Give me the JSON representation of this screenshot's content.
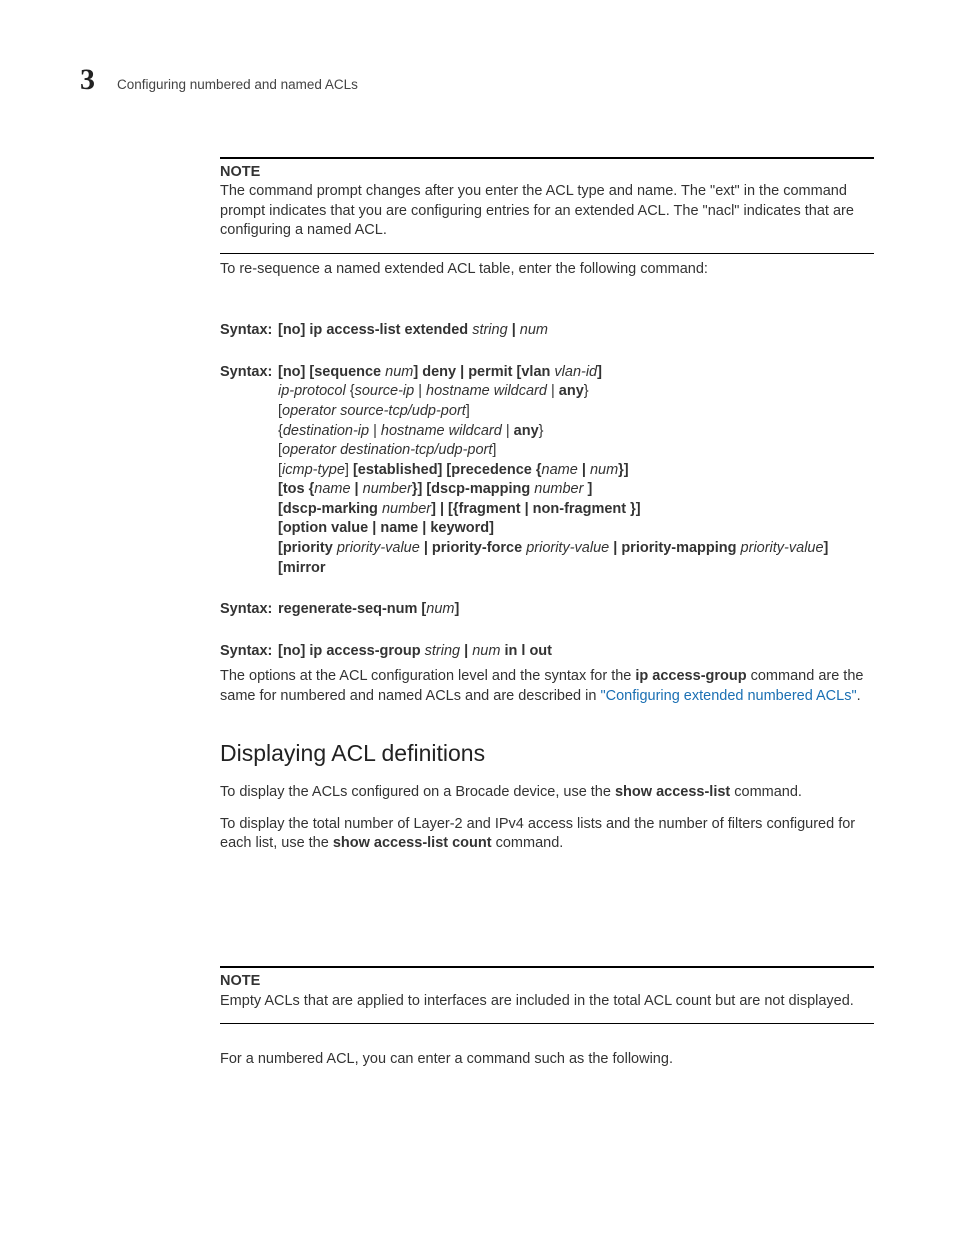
{
  "header": {
    "chapter_number": "3",
    "running_head": "Configuring numbered and named ACLs"
  },
  "note1": {
    "label": "NOTE",
    "text": " The command prompt changes after you enter the ACL type and name. The \"ext\" in the command prompt indicates that you are configuring entries for an extended ACL. The \"nacl\" indicates that are configuring a named ACL."
  },
  "para_reseq": "To re-sequence a named extended ACL table, enter the following command:",
  "syntax1": {
    "label": "Syntax:",
    "parts": [
      {
        "t": "[no] ip access-list extended ",
        "b": true
      },
      {
        "t": "string",
        "i": true
      },
      {
        "t": " | ",
        "b": true
      },
      {
        "t": "num",
        "i": true
      }
    ]
  },
  "syntax2": {
    "label": "Syntax:",
    "lines": [
      [
        {
          "t": "[no] [sequence ",
          "b": true
        },
        {
          "t": "num",
          "i": true
        },
        {
          "t": "] deny | permit  [vlan ",
          "b": true
        },
        {
          "t": "vlan-id",
          "i": true
        },
        {
          "t": "]",
          "b": true
        }
      ],
      [
        {
          "t": "ip-protocol",
          "i": true
        },
        {
          "t": " {"
        },
        {
          "t": "source-ip",
          "i": true
        },
        {
          "t": " | "
        },
        {
          "t": "hostname wildcard",
          "i": true
        },
        {
          "t": " | "
        },
        {
          "t": "any",
          "b": true
        },
        {
          "t": "}"
        }
      ],
      [
        {
          "t": "["
        },
        {
          "t": "operator source-tcp/udp-port",
          "i": true
        },
        {
          "t": "]"
        }
      ],
      [
        {
          "t": "{"
        },
        {
          "t": "destination-ip",
          "i": true
        },
        {
          "t": " | "
        },
        {
          "t": "hostname wildcard",
          "i": true
        },
        {
          "t": " | "
        },
        {
          "t": "any",
          "b": true
        },
        {
          "t": "}"
        }
      ],
      [
        {
          "t": "["
        },
        {
          "t": "operator destination-tcp/udp-port",
          "i": true
        },
        {
          "t": "]"
        }
      ],
      [
        {
          "t": "["
        },
        {
          "t": "icmp-type",
          "i": true
        },
        {
          "t": "] "
        },
        {
          "t": "[established] [precedence {",
          "b": true
        },
        {
          "t": "name",
          "i": true
        },
        {
          "t": " | ",
          "b": true
        },
        {
          "t": "num",
          "i": true
        },
        {
          "t": "}]",
          "b": true
        }
      ],
      [
        {
          "t": "[tos {",
          "b": true
        },
        {
          "t": "name",
          "i": true
        },
        {
          "t": " | ",
          "b": true
        },
        {
          "t": "number",
          "i": true
        },
        {
          "t": "}] [dscp-mapping ",
          "b": true
        },
        {
          "t": "number",
          "i": true
        },
        {
          "t": " ]",
          "b": true
        }
      ],
      [
        {
          "t": "[dscp-marking ",
          "b": true
        },
        {
          "t": "number",
          "i": true
        },
        {
          "t": "] | [{fragment | non-fragment }]",
          "b": true
        }
      ],
      [
        {
          "t": "[option value | name | keyword]",
          "b": true
        }
      ],
      [
        {
          "t": "[priority ",
          "b": true
        },
        {
          "t": "priority-value",
          "i": true
        },
        {
          "t": " | priority-force ",
          "b": true
        },
        {
          "t": "priority-value",
          "i": true
        },
        {
          "t": " | priority-mapping ",
          "b": true
        },
        {
          "t": "priority-value",
          "i": true
        },
        {
          "t": "]",
          "b": true
        }
      ],
      [
        {
          "t": "[mirror",
          "b": true
        }
      ]
    ]
  },
  "syntax3": {
    "label": "Syntax:",
    "parts": [
      {
        "t": "regenerate-seq-num [",
        "b": true
      },
      {
        "t": "num",
        "i": true
      },
      {
        "t": "]",
        "b": true
      }
    ]
  },
  "syntax4": {
    "label": "Syntax:",
    "parts": [
      {
        "t": "[no] ip access-group ",
        "b": true
      },
      {
        "t": "string",
        "i": true
      },
      {
        "t": " | ",
        "b": true
      },
      {
        "t": "num",
        "i": true
      },
      {
        "t": " in l out",
        "b": true
      }
    ]
  },
  "para_options": {
    "pre": "The options at the ACL configuration level and the syntax for the ",
    "bold": "ip access-group",
    "mid": " command are the same for numbered and named ACLs and are described in ",
    "link": "\"Configuring extended numbered ACLs\"",
    "post": "."
  },
  "section_heading": "Displaying ACL definitions",
  "para_display1": {
    "pre": "To display the ACLs configured on a Brocade device, use the ",
    "bold": "show access-list",
    "post": " command."
  },
  "para_display2": {
    "pre": "To display the total number of Layer-2 and IPv4 access lists and the number of filters configured for each list, use the ",
    "bold": "show access-list count",
    "post": " command."
  },
  "note2": {
    "label": "NOTE",
    "text": "Empty ACLs that are applied to interfaces are included in the total ACL count but are not displayed."
  },
  "para_numbered": "For a numbered ACL, you can enter a command such as the following."
}
